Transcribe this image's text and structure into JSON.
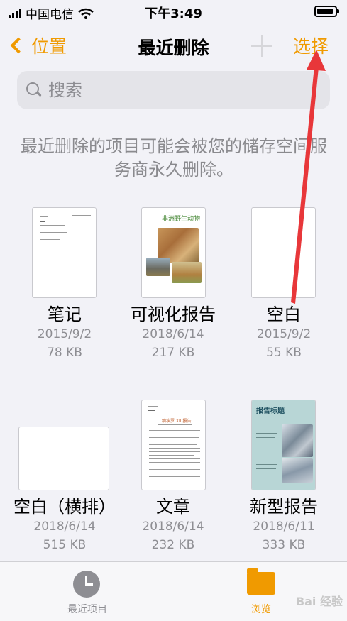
{
  "status_bar": {
    "carrier": "中国电信",
    "time": "下午3:49"
  },
  "nav": {
    "back_label": "位置",
    "title": "最近删除",
    "select_label": "选择"
  },
  "search": {
    "placeholder": "搜索"
  },
  "notice": "最近删除的项目可能会被您的储存空间服务商永久删除。",
  "items": [
    {
      "name": "笔记",
      "date": "2015/9/2",
      "size": "78 KB"
    },
    {
      "name": "可视化报告",
      "date": "2018/6/14",
      "size": "217 KB",
      "thumb_title": "非洲野生动物"
    },
    {
      "name": "空白",
      "date": "2015/9/2",
      "size": "55 KB"
    },
    {
      "name": "空白（横排）",
      "date": "2018/6/14",
      "size": "515 KB"
    },
    {
      "name": "文章",
      "date": "2018/6/14",
      "size": "232 KB",
      "thumb_title": "纳埃罗 XII 报告"
    },
    {
      "name": "新型报告",
      "date": "2018/6/11",
      "size": "333 KB",
      "thumb_title": "报告标题"
    }
  ],
  "tabs": [
    {
      "label": "最近项目",
      "icon": "clock-icon"
    },
    {
      "label": "浏览",
      "icon": "folder-icon"
    }
  ],
  "watermark": "Bai 经验",
  "colors": {
    "accent": "#f09a00",
    "annotation": "#e8373a",
    "background": "#f2f2f7"
  }
}
